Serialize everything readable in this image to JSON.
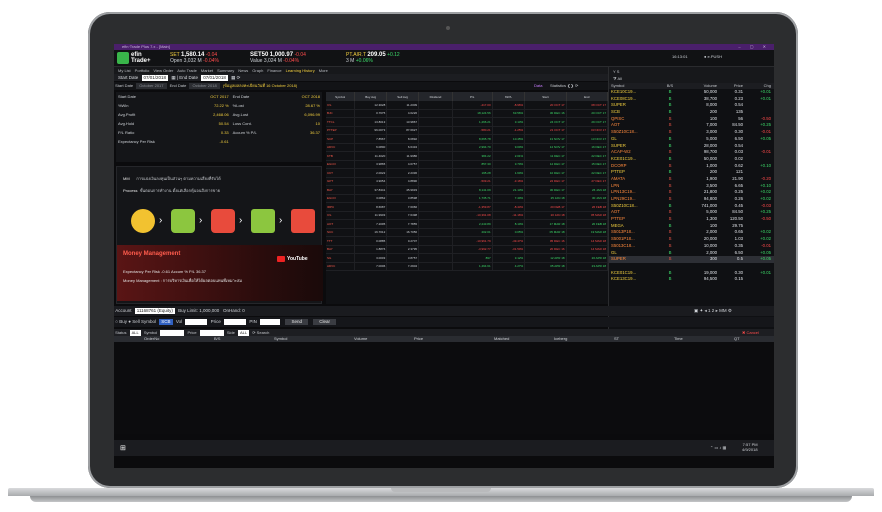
{
  "window": {
    "title": "efin·Trade Plus 7.x - [Main]",
    "controls": "–  ▢  ✕"
  },
  "logo": {
    "line1": "efin",
    "line2": "Trade+"
  },
  "ticker": [
    {
      "name": "SET",
      "value": "1,580.14",
      "change": "-0.04",
      "sub": "Open",
      "vol": "3,032 M",
      "pct": "-0.04%"
    },
    {
      "name": "SET50",
      "value": "1,000.97",
      "change": "-0.04",
      "sub": "Value",
      "vol": "3,024 M",
      "pct": "-0.04%"
    },
    {
      "name": "PT.AIR.T",
      "value": "209.05",
      "change": "+0.12",
      "vol": "3 M",
      "pct": "+0.06%"
    }
  ],
  "header_right": {
    "time": "16:13:01",
    "brand": "e.PUSH"
  },
  "menu": [
    "My List",
    "Portfolio",
    "View Order",
    "Auto Trade",
    "Market",
    "Summary",
    "News",
    "Graph",
    "Finance",
    "Learning History",
    "More"
  ],
  "menu_active": "Learning History",
  "dates": {
    "start_label": "Start Date",
    "start": "07/01/2018",
    "end_label": "End Date",
    "end": "07/01/2018"
  },
  "controls": {
    "start_label": "Start Date",
    "start": "October 2017",
    "end_label": "End Date",
    "end": "October 2018",
    "note": "(ข้อมูลผลลงทะเบียนวันที่ 16 October 2018)",
    "link": "Data",
    "stats_label": "Statistics"
  },
  "stats": [
    [
      "Start Date",
      "OCT 2017",
      "End Date",
      "OCT 2018"
    ],
    [
      "%Win",
      "72.22 %",
      "%Lost",
      "28.67 %"
    ],
    [
      "Avg.Profit",
      "2,468.06",
      "Avg.Lost",
      "6,096.99"
    ],
    [
      "Avg.Hold",
      "50.54",
      "Loss Cont.",
      "10"
    ],
    [
      "P/L Ratio",
      "0.33",
      "Accum % P/L",
      "36.37"
    ],
    [
      "Expectancy Per Risk",
      "-0.61",
      "",
      ""
    ]
  ],
  "mm": {
    "row1_label": "MM",
    "row1_text": "การแบ่งเงินลงทุนเป็นส่วนๆ ตามความเสี่ยงที่รับได้",
    "row2_label": "Process",
    "row2_text": "ขั้นตอนการทำงาน ตั้งแต่เลือกหุ้นจนถึงการขาย",
    "banner_title": "Money Management",
    "banner_l1": "Expectancy Per Risk  -0.61    Accum % P/L  36.37",
    "banner_l2": "Money Management :  การบริหารเงินเพื่อให้ได้ผลตอบแทนที่เหมาะสม",
    "youtube": "YouTube"
  },
  "mid_headers": [
    "Symbol",
    "Buy Avg",
    "Sell Avg",
    "Dividend",
    "P/L",
    "%P/L",
    "Start",
    "End"
  ],
  "mid_rows": [
    [
      "IVL",
      "12.3028",
      "11.2009",
      "",
      "-417.00",
      "-8.96%",
      "20 OCT 17",
      "08 OCT 17"
    ],
    [
      "BJC",
      "0.7675",
      "4.0226",
      "",
      "18,124.56",
      "63.56%",
      "30 DEC 16",
      "20 OCT 17"
    ],
    [
      "TTCL",
      "13.8013",
      "13.9867",
      "",
      "1,266.21",
      "3.13%",
      "24 OCT 17",
      "29 OCT 17"
    ],
    [
      "PTTEP",
      "96.0073",
      "87.6927",
      "",
      "-580.21",
      "-1.25%",
      "21 OCT 17",
      "03 NOV 17"
    ],
    [
      "SCP",
      "7.8567",
      "8.0892",
      "",
      "8,665.78",
      "10.45%",
      "13 NOV 17",
      "13 NOV 17"
    ],
    [
      "ADVC",
      "6.0890",
      "6.6434",
      "",
      "2,994.70",
      "9.00%",
      "14 NOV 17",
      "16 DEC 17"
    ],
    [
      "KTB",
      "11.4020",
      "11.9986",
      "",
      "384.22",
      "2.01%",
      "11 DEC 17",
      "22 DEC 17"
    ],
    [
      "EGCO",
      "3.9865",
      "4.0757",
      "",
      "857.30",
      "3.70%",
      "12 DEC 17",
      "15 DEC 17"
    ],
    [
      "CKT",
      "2.0022",
      "2.2336",
      "",
      "195.28",
      "1.60%",
      "10 DEC 17",
      "22 DEC 17"
    ],
    [
      "GPT",
      "4.9054",
      "4.8890",
      "",
      "-509.21",
      "-3.16%",
      "22 DEC 17",
      "27 DEC 17"
    ],
    [
      "BAY",
      "37.8341",
      "45.9933",
      "",
      "8,141.09",
      "21.13%",
      "30 DEC 17",
      "26 JAN 18"
    ],
    [
      "EGCO",
      "3.0862",
      "3.8598",
      "",
      "1,735.71",
      "7.40%",
      "25 JAN 18",
      "30 JAN 18"
    ],
    [
      "IRPC",
      "8.6687",
      "7.6066",
      "",
      "-1,359.87",
      "-8.43%",
      "20 FEB 17",
      "26 FEB 18"
    ],
    [
      "IVL",
      "11.9903",
      "7.6498",
      "",
      "-10,391.08",
      "-11.16%",
      "20 JAN 18",
      "05 MAR 18"
    ],
    [
      "AOT",
      "7.2095",
      "7.7855",
      "",
      "2,243.89",
      "8.10%",
      "17 MAR 18",
      "20 FEB 18"
    ],
    [
      "SCC",
      "16.7012",
      "16.7056",
      "",
      "202.01",
      "0.05%",
      "05 MAR 18",
      "19 MAR 18"
    ],
    [
      "TTT",
      "0.0885",
      "0.2707",
      "",
      "-10,961.79",
      "-49.47%",
      "05 DEC 16",
      "14 MAR 18"
    ],
    [
      "BAY",
      "1.8876",
      "2.3795",
      "",
      "-3,992.77",
      "-31.50%",
      "20 DEC 16",
      "14 MAR 18"
    ],
    [
      "SG",
      "3.0003",
      "3.8757",
      "",
      "897",
      "3.12%",
      "12 APR 18",
      "20 APR 18"
    ],
    [
      "ADVC",
      "7.0006",
      "7.2904",
      "",
      "1,494.61",
      "4.27%",
      "05 APR 18",
      "23 APR 18"
    ]
  ],
  "right_top": {
    "tabs": "Y  S",
    "search": "All"
  },
  "right_headers": [
    "Symbol",
    "B/S",
    "Volume",
    "Price",
    "Chg"
  ],
  "right_rows": [
    [
      "KCE10C19...",
      "B",
      "50,000",
      "0.31",
      "+0.01"
    ],
    [
      "KCE08C19...",
      "B",
      "38,700",
      "0.23",
      "+0.01"
    ],
    [
      "SUPER",
      "B",
      "8,000",
      "0.54",
      ""
    ],
    [
      "SCB",
      "B",
      "200",
      "135",
      ""
    ],
    [
      "QPISC",
      "S",
      "100",
      "56",
      "-0.50"
    ],
    [
      "AOT",
      "S",
      "7,000",
      "84.50",
      "+0.25"
    ],
    [
      "S50Z10C18...",
      "S",
      "3,000",
      "0.30",
      "-0.01"
    ],
    [
      "GL",
      "B",
      "5,000",
      "6.50",
      "+0.05"
    ],
    [
      "SUPER",
      "B",
      "28,000",
      "0.54",
      ""
    ],
    [
      "ACAP-W2",
      "S",
      "98,700",
      "0.03",
      "-0.01"
    ],
    [
      "KCE01C19...",
      "B",
      "50,000",
      "0.02",
      ""
    ],
    [
      "DCORP",
      "S",
      "1,000",
      "0.62",
      "+0.10"
    ],
    [
      "PTTEP",
      "B",
      "200",
      "121",
      ""
    ],
    [
      "AMATA",
      "S",
      "1,900",
      "21.90",
      "-0.20"
    ],
    [
      "LPN",
      "S",
      "3,500",
      "6.65",
      "+0.10"
    ],
    [
      "LPN13C19...",
      "S",
      "21,800",
      "0.25",
      "+0.02"
    ],
    [
      "LPN29C19...",
      "S",
      "94,800",
      "0.26",
      "+0.02"
    ],
    [
      "S50Z10C18...",
      "B",
      "741,000",
      "0.45",
      "-0.03"
    ],
    [
      "AOT",
      "S",
      "5,000",
      "84.50",
      "+0.25"
    ],
    [
      "PTTEP",
      "S",
      "1,300",
      "120.50",
      "-0.50"
    ],
    [
      "MEGA",
      "B",
      "100",
      "29.75",
      ""
    ],
    [
      "S5013P18...",
      "S",
      "2,000",
      "0.65",
      "+0.02"
    ],
    [
      "S5001P18...",
      "S",
      "20,000",
      "1.03",
      "+0.02"
    ],
    [
      "S5013C18...",
      "S",
      "10,000",
      "0.35",
      "-0.01"
    ],
    [
      "GL",
      "B",
      "2,000",
      "6.50",
      "+0.05"
    ],
    [
      "SUPER",
      "S",
      "300",
      "0.5",
      "+0.05"
    ],
    [
      "",
      "",
      "",
      "",
      ""
    ],
    [
      "KCE01C19...",
      "B",
      "19,000",
      "0.30",
      "+0.01"
    ],
    [
      "KCE13C19...",
      "B",
      "94,500",
      "0.15",
      ""
    ]
  ],
  "order": {
    "account_label": "Account",
    "account": "11168761 (Equity)",
    "buy_limit_label": "Buy Limit",
    "buy_limit": "1,000,000",
    "onhand_label": "OnHand",
    "onhand": "0",
    "buy": "Buy",
    "sell": "Sell",
    "symbol_label": "Symbol",
    "symbol": "SCB",
    "vol_label": "Vol",
    "price_label": "Price",
    "pin_label": "PIN",
    "send": "Send",
    "clear": "Clear",
    "page": "2",
    "mm": "MM"
  },
  "filter": {
    "status_label": "Status",
    "status": "ALL",
    "symbol_label": "Symbol",
    "price_label": "Price",
    "side_label": "Side",
    "side": "ALL",
    "search": "Search",
    "cancel": "Cancel"
  },
  "order_headers": [
    "OrderNo",
    "B/S",
    "Symbol",
    "Volume",
    "Price",
    "Matched",
    "Iceberg",
    "ST",
    "Time",
    "QT"
  ],
  "taskbar": {
    "time": "7:57 PM",
    "date": "4/9/2018"
  }
}
